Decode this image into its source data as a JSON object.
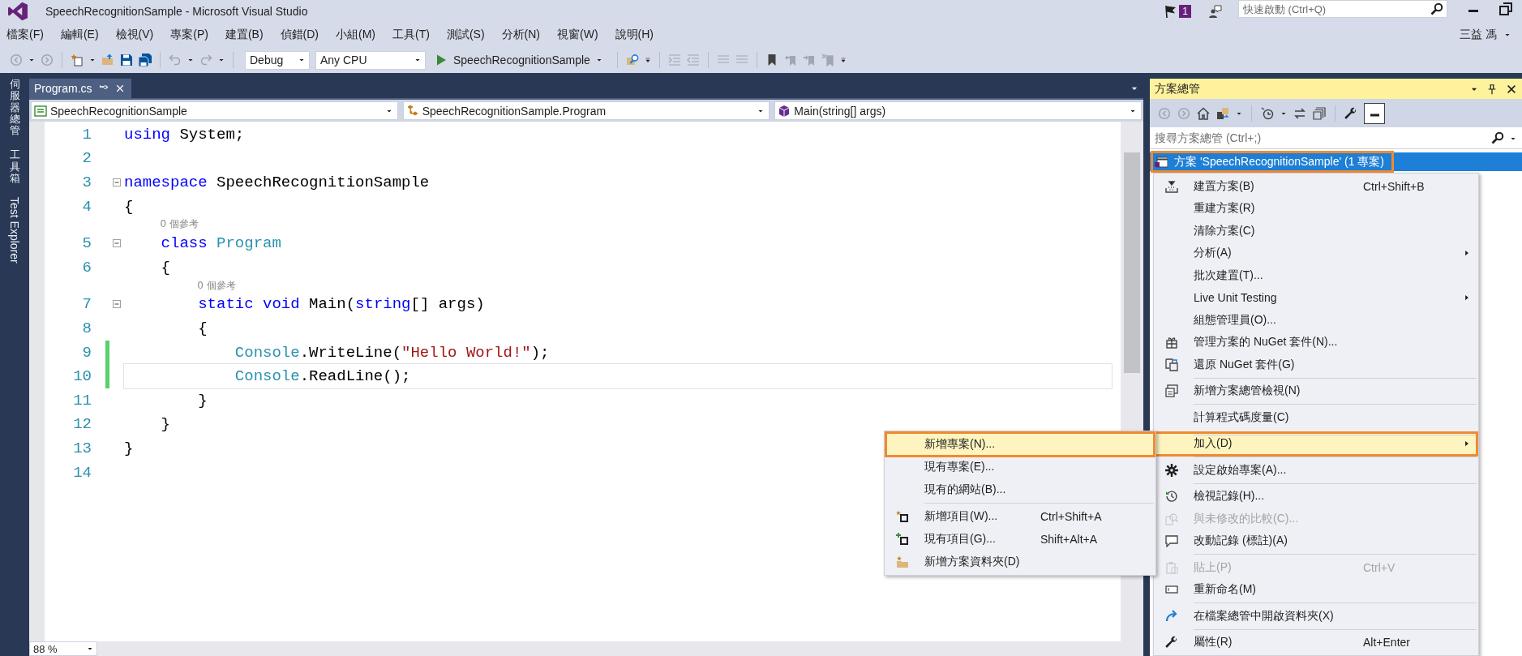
{
  "window": {
    "title": "SpeechRecognitionSample - Microsoft Visual Studio",
    "notification_count": "1",
    "quick_launch": {
      "placeholder": "快速啟動 (Ctrl+Q)"
    },
    "user": "三益 馮"
  },
  "menu_bar": [
    "檔案(F)",
    "編輯(E)",
    "檢視(V)",
    "專案(P)",
    "建置(B)",
    "偵錯(D)",
    "小組(M)",
    "工具(T)",
    "測試(S)",
    "分析(N)",
    "視窗(W)",
    "說明(H)"
  ],
  "toolbar": {
    "configuration": "Debug",
    "platform": "Any CPU",
    "start": "SpeechRecognitionSample"
  },
  "side_tabs": [
    {
      "label": "伺服器總管",
      "kind": "cjk"
    },
    {
      "label": "工具箱",
      "kind": "cjk"
    },
    {
      "label": "Test Explorer",
      "kind": "latin"
    }
  ],
  "editor": {
    "tabs": [
      {
        "label": "Program.cs",
        "selected": true
      }
    ],
    "nav": [
      "SpeechRecognitionSample",
      "SpeechRecognitionSample.Program",
      "Main(string[] args)"
    ],
    "lines": [
      {
        "number": "1",
        "tokens": [
          {
            "text": "using",
            "kind": "keyword"
          },
          {
            "text": " System;",
            "kind": "plain"
          }
        ],
        "foldable": false,
        "changed": false,
        "current": false
      },
      {
        "number": "2",
        "foldable": false,
        "changed": false,
        "current": false
      },
      {
        "number": "3",
        "tokens": [
          {
            "text": "namespace",
            "kind": "keyword"
          },
          {
            "text": " SpeechRecognitionSample",
            "kind": "plain"
          }
        ],
        "foldable": true,
        "changed": false,
        "current": false
      },
      {
        "number": "4",
        "tokens": [
          {
            "text": "{",
            "kind": "plain"
          }
        ],
        "foldable": false,
        "changed": false,
        "current": false
      },
      {
        "number": "5",
        "codelens": "0 個參考",
        "tokens": [
          {
            "text": "    class",
            "kind": "keyword"
          },
          {
            "text": " Program",
            "kind": "type"
          }
        ],
        "foldable": true,
        "changed": false,
        "current": false
      },
      {
        "number": "6",
        "tokens": [
          {
            "text": "    {",
            "kind": "plain"
          }
        ],
        "foldable": false,
        "changed": false,
        "current": false
      },
      {
        "number": "7",
        "codelens": "0 個參考",
        "tokens": [
          {
            "text": "        static",
            "kind": "keyword"
          },
          {
            "text": " void",
            "kind": "keyword"
          },
          {
            "text": " Main(",
            "kind": "plain"
          },
          {
            "text": "string",
            "kind": "keyword"
          },
          {
            "text": "[] args)",
            "kind": "plain"
          }
        ],
        "foldable": true,
        "changed": false,
        "current": false
      },
      {
        "number": "8",
        "tokens": [
          {
            "text": "        {",
            "kind": "plain"
          }
        ],
        "foldable": false,
        "changed": false,
        "current": false
      },
      {
        "number": "9",
        "tokens": [
          {
            "text": "            Console",
            "kind": "type"
          },
          {
            "text": ".WriteLine(",
            "kind": "plain"
          },
          {
            "text": "\"Hello World!\"",
            "kind": "string"
          },
          {
            "text": ");",
            "kind": "plain"
          }
        ],
        "foldable": false,
        "changed": true,
        "current": false
      },
      {
        "number": "10",
        "tokens": [
          {
            "text": "            Console",
            "kind": "type"
          },
          {
            "text": ".ReadLine();",
            "kind": "plain"
          }
        ],
        "foldable": false,
        "changed": true,
        "current": true
      },
      {
        "number": "11",
        "tokens": [
          {
            "text": "        }",
            "kind": "plain"
          }
        ],
        "foldable": false,
        "changed": false,
        "current": false
      },
      {
        "number": "12",
        "tokens": [
          {
            "text": "    }",
            "kind": "plain"
          }
        ],
        "foldable": false,
        "changed": false,
        "current": false
      },
      {
        "number": "13",
        "tokens": [
          {
            "text": "}",
            "kind": "plain"
          }
        ],
        "foldable": false,
        "changed": false,
        "current": false
      },
      {
        "number": "14",
        "foldable": false,
        "changed": false,
        "current": false
      }
    ],
    "zoom": "88 %"
  },
  "solution_explorer": {
    "title": "方案總管",
    "search": {
      "placeholder": "搜尋方案總管 (Ctrl+;)"
    },
    "tree": [
      {
        "label": "方案 'SpeechRecognitionSample' (1 專案)",
        "selected": true,
        "annotated": true
      }
    ]
  },
  "context_menu": {
    "items": [
      {
        "label": "建置方案(B)",
        "shortcut": "Ctrl+Shift+B",
        "submenu": false,
        "disabled": false,
        "highlighted": false,
        "annotated": false,
        "separator_before": false
      },
      {
        "label": "重建方案(R)",
        "submenu": false,
        "disabled": false,
        "highlighted": false,
        "annotated": false,
        "separator_before": false
      },
      {
        "label": "清除方案(C)",
        "submenu": false,
        "disabled": false,
        "highlighted": false,
        "annotated": false,
        "separator_before": false
      },
      {
        "label": "分析(A)",
        "submenu": true,
        "disabled": false,
        "highlighted": false,
        "annotated": false,
        "separator_before": false
      },
      {
        "label": "批次建置(T)...",
        "submenu": false,
        "disabled": false,
        "highlighted": false,
        "annotated": false,
        "separator_before": false
      },
      {
        "label": "Live Unit Testing",
        "submenu": true,
        "disabled": false,
        "highlighted": false,
        "annotated": false,
        "separator_before": false
      },
      {
        "label": "組態管理員(O)...",
        "submenu": false,
        "disabled": false,
        "highlighted": false,
        "annotated": false,
        "separator_before": false
      },
      {
        "label": "管理方案的 NuGet 套件(N)...",
        "submenu": false,
        "disabled": false,
        "highlighted": false,
        "annotated": false,
        "separator_before": false
      },
      {
        "label": "還原 NuGet 套件(G)",
        "submenu": false,
        "disabled": false,
        "highlighted": false,
        "annotated": false,
        "separator_before": false
      },
      {
        "label": "新增方案總管檢視(N)",
        "submenu": false,
        "disabled": false,
        "highlighted": false,
        "annotated": false,
        "separator_before": true
      },
      {
        "label": "計算程式碼度量(C)",
        "submenu": false,
        "disabled": false,
        "highlighted": false,
        "annotated": false,
        "separator_before": true
      },
      {
        "label": "加入(D)",
        "submenu": true,
        "disabled": false,
        "highlighted": true,
        "annotated": true,
        "separator_before": true
      },
      {
        "label": "設定啟始專案(A)...",
        "submenu": false,
        "disabled": false,
        "highlighted": false,
        "annotated": false,
        "separator_before": true
      },
      {
        "label": "檢視記錄(H)...",
        "submenu": false,
        "disabled": false,
        "highlighted": false,
        "annotated": false,
        "separator_before": true
      },
      {
        "label": "與未修改的比較(C)...",
        "submenu": false,
        "disabled": true,
        "highlighted": false,
        "annotated": false,
        "separator_before": false
      },
      {
        "label": "改動記錄 (標註)(A)",
        "submenu": false,
        "disabled": false,
        "highlighted": false,
        "annotated": false,
        "separator_before": false
      },
      {
        "label": "貼上(P)",
        "shortcut": "Ctrl+V",
        "submenu": false,
        "disabled": true,
        "highlighted": false,
        "annotated": false,
        "separator_before": true
      },
      {
        "label": "重新命名(M)",
        "submenu": false,
        "disabled": false,
        "highlighted": false,
        "annotated": false,
        "separator_before": false
      },
      {
        "label": "在檔案總管中開啟資料夾(X)",
        "submenu": false,
        "disabled": false,
        "highlighted": false,
        "annotated": false,
        "separator_before": true
      },
      {
        "label": "屬性(R)",
        "shortcut": "Alt+Enter",
        "submenu": false,
        "disabled": false,
        "highlighted": false,
        "annotated": false,
        "separator_before": true
      }
    ]
  },
  "submenu": {
    "items": [
      {
        "label": "新增專案(N)...",
        "highlighted": true,
        "annotated": true,
        "separator_before": false
      },
      {
        "label": "現有專案(E)...",
        "highlighted": false,
        "annotated": false,
        "separator_before": false
      },
      {
        "label": "現有的網站(B)...",
        "highlighted": false,
        "annotated": false,
        "separator_before": false
      },
      {
        "label": "新增項目(W)...",
        "shortcut": "Ctrl+Shift+A",
        "highlighted": false,
        "annotated": false,
        "separator_before": true
      },
      {
        "label": "現有項目(G)...",
        "shortcut": "Shift+Alt+A",
        "highlighted": false,
        "annotated": false,
        "separator_before": false
      },
      {
        "label": "新增方案資料夾(D)",
        "highlighted": false,
        "annotated": false,
        "separator_before": false
      }
    ]
  }
}
